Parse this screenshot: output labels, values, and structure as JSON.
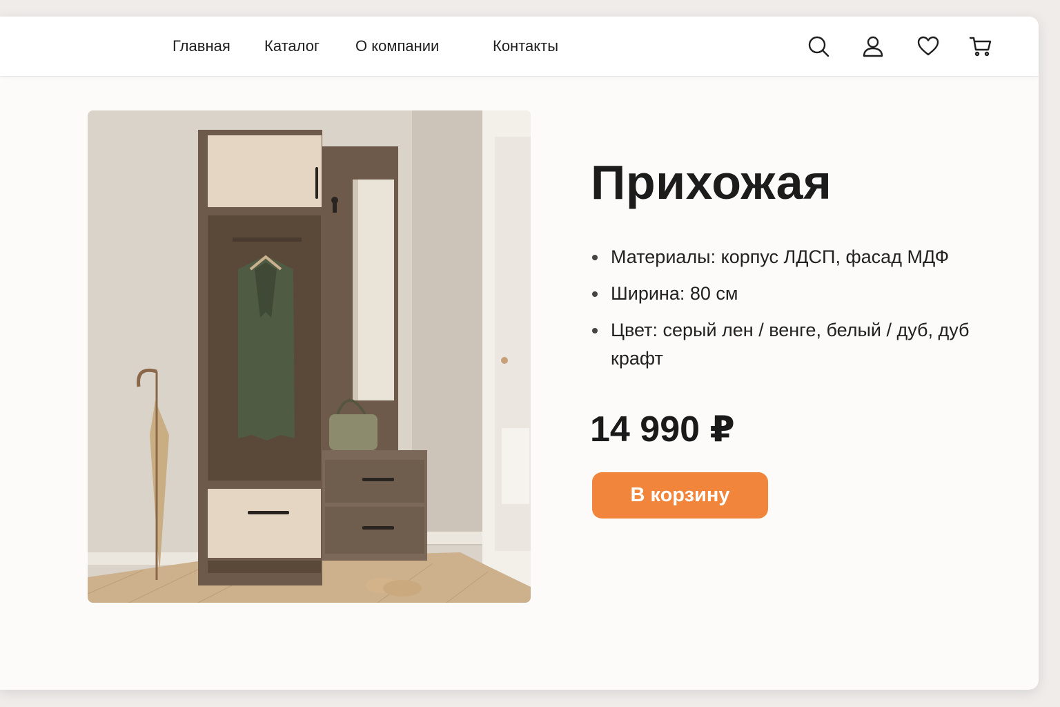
{
  "nav": {
    "links": [
      "Главная",
      "Каталог",
      "О компании",
      "Контакты"
    ],
    "icons": [
      "search-icon",
      "user-icon",
      "heart-icon",
      "cart-icon"
    ]
  },
  "product": {
    "title": "Прихожая",
    "specs": [
      "Материалы: корпус ЛДСП, фасад МДФ",
      "Ширина: 80 см",
      "Цвет: серый лен / венге, белый / дуб, дуб крафт"
    ],
    "price": "14 990 ₽",
    "cta_label": "В корзину",
    "image_description_icon": "hallway-furniture-photo"
  },
  "colors": {
    "accent": "#f0853b",
    "page_bg": "#fcfbf9",
    "header_bg": "#ffffff",
    "text": "#1f1f1f"
  }
}
